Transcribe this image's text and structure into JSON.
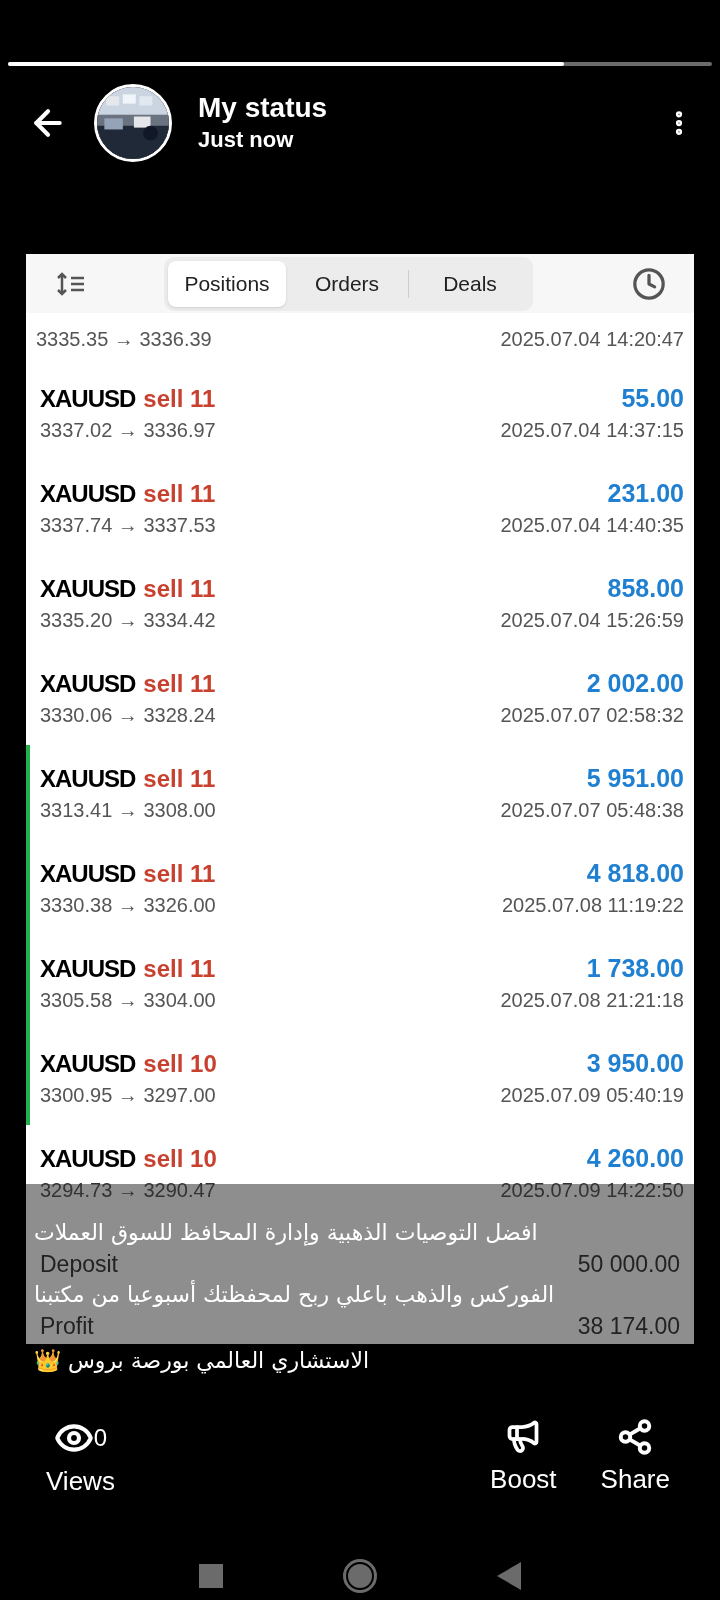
{
  "progress": {
    "level": 0.79
  },
  "header": {
    "title": "My status",
    "subtitle": "Just now"
  },
  "tabs": [
    {
      "label": "Positions",
      "selected": true
    },
    {
      "label": "Orders",
      "selected": false
    },
    {
      "label": "Deals",
      "selected": false
    }
  ],
  "partial_row": {
    "prices": "3335.35 → 3336.39",
    "time": "2025.07.04 14:20:47"
  },
  "rows": [
    {
      "symbol": "XAUUSD",
      "type": "sell",
      "volume": "11",
      "profit": "55.00",
      "prices": "3337.02 → 3336.97",
      "time": "2025.07.04 14:37:15",
      "highlighted": false
    },
    {
      "symbol": "XAUUSD",
      "type": "sell",
      "volume": "11",
      "profit": "231.00",
      "prices": "3337.74 → 3337.53",
      "time": "2025.07.04 14:40:35",
      "highlighted": false
    },
    {
      "symbol": "XAUUSD",
      "type": "sell",
      "volume": "11",
      "profit": "858.00",
      "prices": "3335.20 → 3334.42",
      "time": "2025.07.04 15:26:59",
      "highlighted": false
    },
    {
      "symbol": "XAUUSD",
      "type": "sell",
      "volume": "11",
      "profit": "2 002.00",
      "prices": "3330.06 → 3328.24",
      "time": "2025.07.07 02:58:32",
      "highlighted": false
    },
    {
      "symbol": "XAUUSD",
      "type": "sell",
      "volume": "11",
      "profit": "5 951.00",
      "prices": "3313.41 → 3308.00",
      "time": "2025.07.07 05:48:38",
      "highlighted": true
    },
    {
      "symbol": "XAUUSD",
      "type": "sell",
      "volume": "11",
      "profit": "4 818.00",
      "prices": "3330.38 → 3326.00",
      "time": "2025.07.08 11:19:22",
      "highlighted": true
    },
    {
      "symbol": "XAUUSD",
      "type": "sell",
      "volume": "11",
      "profit": "1 738.00",
      "prices": "3305.58 → 3304.00",
      "time": "2025.07.08 21:21:18",
      "highlighted": true
    },
    {
      "symbol": "XAUUSD",
      "type": "sell",
      "volume": "10",
      "profit": "3 950.00",
      "prices": "3300.95 → 3297.00",
      "time": "2025.07.09 05:40:19",
      "highlighted": true
    },
    {
      "symbol": "XAUUSD",
      "type": "sell",
      "volume": "10",
      "profit": "4 260.00",
      "prices": "3294.73 → 3290.47",
      "time": "2025.07.09 14:22:50",
      "highlighted": false
    }
  ],
  "summary": [
    {
      "label": "Deposit",
      "value": "50 000.00"
    },
    {
      "label": "Profit",
      "value": "38 174.00"
    }
  ],
  "caption": [
    "افضل التوصيات الذهبية وإدارة المحافظ للسوق العملات",
    "الفوركس والذهب باعلي ربح لمحفظتك أسبوعيا من مكتبنا",
    "الاستشاري العالمي بورصة بروس 👑"
  ],
  "actions": {
    "views_count": "0",
    "views": "Views",
    "boost": "Boost",
    "share": "Share"
  }
}
